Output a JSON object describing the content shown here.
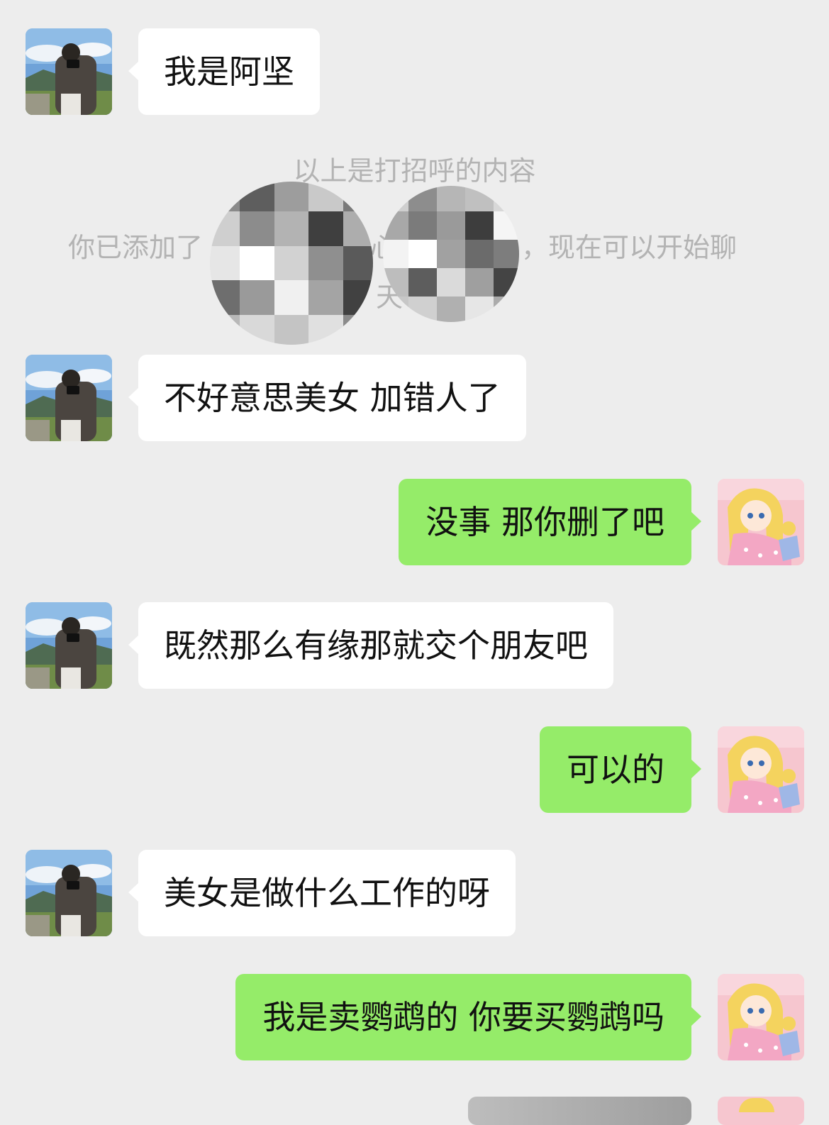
{
  "chat": {
    "system_greeting_note": "以上是打招呼的内容",
    "system_added_note": {
      "left": "你已添加了",
      "mid": "心",
      "right": "，现在可以开始聊",
      "wrap": "天"
    },
    "messages": [
      {
        "side": "in",
        "text": "我是阿坚"
      },
      {
        "side": "in",
        "text": "不好意思美女 加错人了"
      },
      {
        "side": "out",
        "text": "没事 那你删了吧"
      },
      {
        "side": "in",
        "text": "既然那么有缘那就交个朋友吧"
      },
      {
        "side": "out",
        "text": "可以的"
      },
      {
        "side": "in",
        "text": "美女是做什么工作的呀"
      },
      {
        "side": "out",
        "text": "我是卖鹦鹉的 你要买鹦鹉吗"
      }
    ]
  },
  "contacts": {
    "them_avatar_icon": "photographer-landscape-avatar",
    "me_avatar_icon": "anime-girl-avatar"
  },
  "colors": {
    "background": "#ededed",
    "incoming_bubble": "#ffffff",
    "outgoing_bubble": "#95ec69",
    "system_text": "#b3b3b3"
  }
}
